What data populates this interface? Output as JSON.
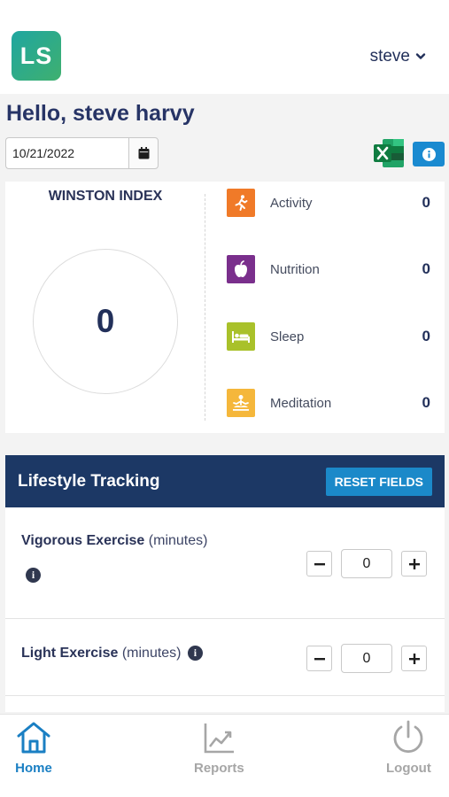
{
  "header": {
    "logo_text": "LS",
    "user_name": "steve"
  },
  "greeting": "Hello, steve harvy",
  "date": {
    "value": "10/21/2022"
  },
  "winston": {
    "title": "WINSTON INDEX",
    "score": "0",
    "metrics": [
      {
        "label": "Activity",
        "value": "0",
        "color": "#f07a28",
        "icon": "running-person-icon"
      },
      {
        "label": "Nutrition",
        "value": "0",
        "color": "#7a2f8c",
        "icon": "apple-icon"
      },
      {
        "label": "Sleep",
        "value": "0",
        "color": "#a9c12a",
        "icon": "bed-icon"
      },
      {
        "label": "Meditation",
        "value": "0",
        "color": "#f5b73b",
        "icon": "meditation-icon"
      }
    ]
  },
  "tracking": {
    "title": "Lifestyle Tracking",
    "reset_label": "RESET FIELDS",
    "rows": [
      {
        "label": "Vigorous Exercise",
        "unit": "(minutes)",
        "value": "0"
      },
      {
        "label": "Light Exercise",
        "unit": "(minutes)",
        "value": "0"
      }
    ]
  },
  "nav": {
    "items": [
      {
        "label": "Home",
        "active": true
      },
      {
        "label": "Reports",
        "active": false
      },
      {
        "label": "Logout",
        "active": false
      }
    ]
  },
  "colors": {
    "accent": "#1b89c9",
    "header_dark": "#1c3865",
    "text_dark": "#2a3358",
    "nav_active": "#1a7fc3",
    "nav_inactive": "#a6a6a6"
  }
}
